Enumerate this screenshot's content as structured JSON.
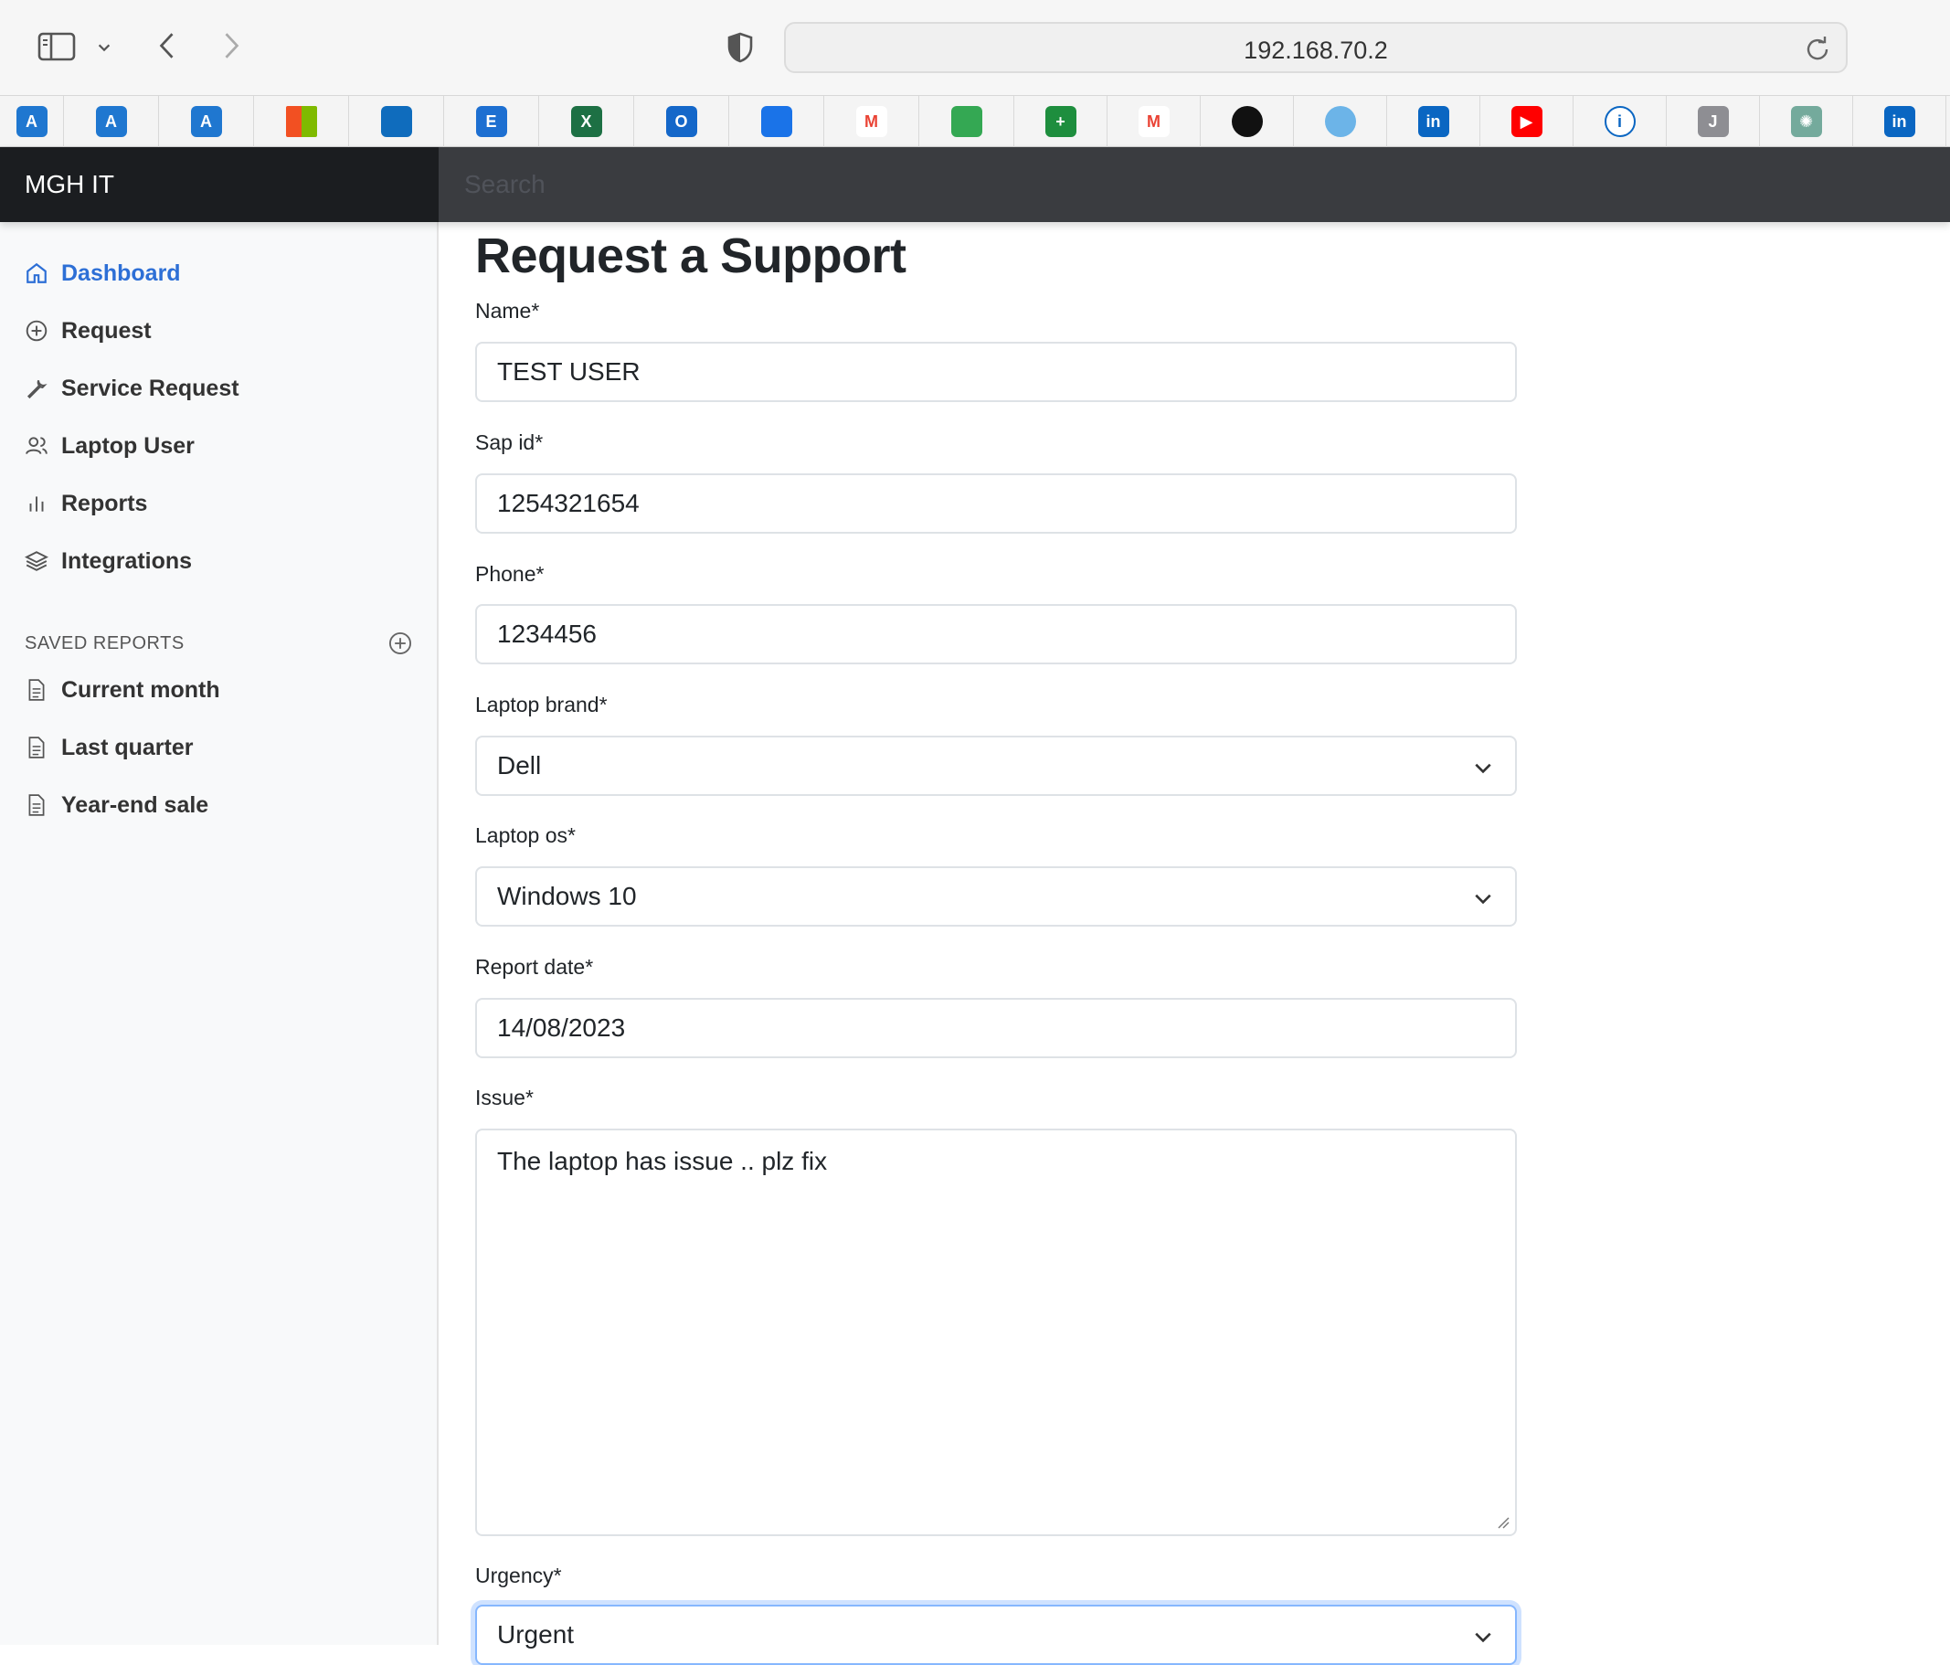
{
  "browser": {
    "url": "192.168.70.2"
  },
  "bookmarks": [
    {
      "icon": "azure-devops-icon",
      "color": "#1f77d0",
      "glyph": "A"
    },
    {
      "icon": "azure-devops-icon",
      "color": "#1f77d0",
      "glyph": "A"
    },
    {
      "icon": "azure-devops-icon",
      "color": "#1f77d0",
      "glyph": "A"
    },
    {
      "icon": "microsoft-icon",
      "color": "#f25022",
      "glyph": ""
    },
    {
      "icon": "sharepoint-icon",
      "color": "#0f6cbd",
      "glyph": ""
    },
    {
      "icon": "exchange-icon",
      "color": "#1d6fd1",
      "glyph": "E"
    },
    {
      "icon": "excel-icon",
      "color": "#1d7044",
      "glyph": "X"
    },
    {
      "icon": "outlook-icon",
      "color": "#1467c9",
      "glyph": "O"
    },
    {
      "icon": "onedrive-icon",
      "color": "#1a73e8",
      "glyph": ""
    },
    {
      "icon": "gmail-icon",
      "color": "#ea4335",
      "glyph": "M"
    },
    {
      "icon": "google-drive-icon",
      "color": "#34a853",
      "glyph": ""
    },
    {
      "icon": "google-sheets-icon",
      "color": "#1e8e3e",
      "glyph": "+"
    },
    {
      "icon": "gmail-icon",
      "color": "#ea4335",
      "glyph": "M"
    },
    {
      "icon": "github-icon",
      "color": "#111111",
      "glyph": ""
    },
    {
      "icon": "circle-app-icon",
      "color": "#6cb4e8",
      "glyph": ""
    },
    {
      "icon": "linkedin-icon",
      "color": "#0a66c2",
      "glyph": "in"
    },
    {
      "icon": "youtube-icon",
      "color": "#ff0000",
      "glyph": "▶"
    },
    {
      "icon": "info-icon",
      "color": "#0a66c2",
      "glyph": "i"
    },
    {
      "icon": "j-app-icon",
      "color": "#8e8e93",
      "glyph": "J"
    },
    {
      "icon": "chatgpt-icon",
      "color": "#74aa9c",
      "glyph": "✺"
    },
    {
      "icon": "linkedin-icon",
      "color": "#0a66c2",
      "glyph": "in"
    }
  ],
  "navbar": {
    "brand": "MGH IT",
    "search_placeholder": "Search"
  },
  "sidebar": {
    "items": [
      {
        "label": "Dashboard",
        "icon": "home-icon",
        "active": true
      },
      {
        "label": "Request",
        "icon": "plus-circle-icon"
      },
      {
        "label": "Service Request",
        "icon": "wrench-icon"
      },
      {
        "label": "Laptop User",
        "icon": "users-icon"
      },
      {
        "label": "Reports",
        "icon": "bar-chart-icon"
      },
      {
        "label": "Integrations",
        "icon": "layers-icon"
      }
    ],
    "saved_reports_heading": "SAVED REPORTS",
    "saved_reports": [
      {
        "label": "Current month",
        "icon": "file-text-icon"
      },
      {
        "label": "Last quarter",
        "icon": "file-text-icon"
      },
      {
        "label": "Year-end sale",
        "icon": "file-text-icon"
      }
    ]
  },
  "form": {
    "title": "Request a Support",
    "name_label": "Name*",
    "name_value": "TEST USER",
    "sapid_label": "Sap id*",
    "sapid_value": "1254321654",
    "phone_label": "Phone*",
    "phone_value": "1234456",
    "brand_label": "Laptop brand*",
    "brand_value": "Dell",
    "os_label": "Laptop os*",
    "os_value": "Windows 10",
    "date_label": "Report date*",
    "date_value": "14/08/2023",
    "issue_label": "Issue*",
    "issue_value": "The laptop has issue .. plz fix",
    "urgency_label": "Urgency*",
    "urgency_value": "Urgent"
  }
}
